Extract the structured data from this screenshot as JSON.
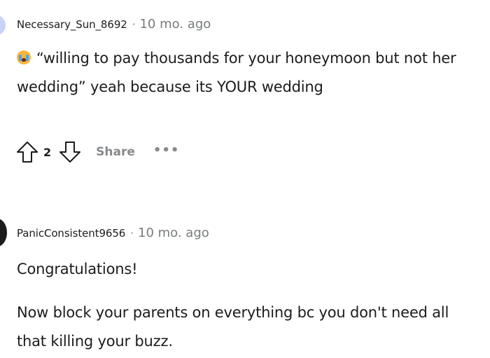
{
  "comments": [
    {
      "username": "Necessary_Sun_8692",
      "separator": "·",
      "timestamp": "10 mo. ago",
      "emoji": "loudly-crying-face-emoji",
      "body": "“willing to pay thousands for your honeymoon but not her wedding” yeah because its YOUR wedding",
      "upvote_icon": "arrow-up-outline-icon",
      "vote_count": "2",
      "downvote_icon": "arrow-down-outline-icon",
      "share_label": "Share",
      "more_label": "•••"
    },
    {
      "username": "PanicConsistent9656",
      "separator": "·",
      "timestamp": "10 mo. ago",
      "paragraphs": [
        "Congratulations!",
        "Now block your parents on everything bc you don't need all that killing your buzz."
      ]
    }
  ],
  "colors": {
    "text": "#1c1c1c",
    "meta": "#787c7e",
    "action": "#878a8c",
    "avatar_1": "#c9d3f5",
    "avatar_2": "#1c1c1c",
    "emoji_face": "#f5b63c"
  }
}
